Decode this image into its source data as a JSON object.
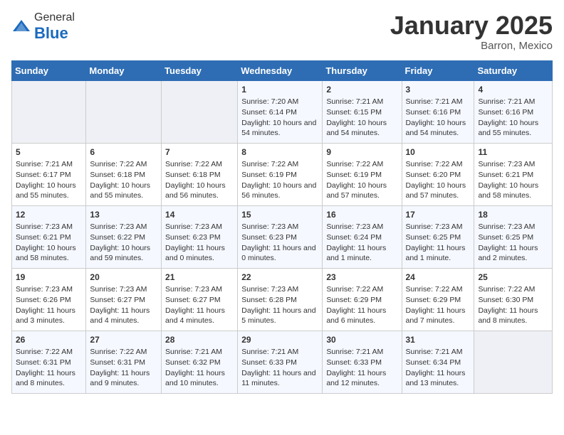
{
  "header": {
    "logo": {
      "general": "General",
      "blue": "Blue"
    },
    "title": "January 2025",
    "location": "Barron, Mexico"
  },
  "days_of_week": [
    "Sunday",
    "Monday",
    "Tuesday",
    "Wednesday",
    "Thursday",
    "Friday",
    "Saturday"
  ],
  "weeks": [
    [
      {
        "day": "",
        "sunrise": "",
        "sunset": "",
        "daylight": ""
      },
      {
        "day": "",
        "sunrise": "",
        "sunset": "",
        "daylight": ""
      },
      {
        "day": "",
        "sunrise": "",
        "sunset": "",
        "daylight": ""
      },
      {
        "day": "1",
        "sunrise": "Sunrise: 7:20 AM",
        "sunset": "Sunset: 6:14 PM",
        "daylight": "Daylight: 10 hours and 54 minutes."
      },
      {
        "day": "2",
        "sunrise": "Sunrise: 7:21 AM",
        "sunset": "Sunset: 6:15 PM",
        "daylight": "Daylight: 10 hours and 54 minutes."
      },
      {
        "day": "3",
        "sunrise": "Sunrise: 7:21 AM",
        "sunset": "Sunset: 6:16 PM",
        "daylight": "Daylight: 10 hours and 54 minutes."
      },
      {
        "day": "4",
        "sunrise": "Sunrise: 7:21 AM",
        "sunset": "Sunset: 6:16 PM",
        "daylight": "Daylight: 10 hours and 55 minutes."
      }
    ],
    [
      {
        "day": "5",
        "sunrise": "Sunrise: 7:21 AM",
        "sunset": "Sunset: 6:17 PM",
        "daylight": "Daylight: 10 hours and 55 minutes."
      },
      {
        "day": "6",
        "sunrise": "Sunrise: 7:22 AM",
        "sunset": "Sunset: 6:18 PM",
        "daylight": "Daylight: 10 hours and 55 minutes."
      },
      {
        "day": "7",
        "sunrise": "Sunrise: 7:22 AM",
        "sunset": "Sunset: 6:18 PM",
        "daylight": "Daylight: 10 hours and 56 minutes."
      },
      {
        "day": "8",
        "sunrise": "Sunrise: 7:22 AM",
        "sunset": "Sunset: 6:19 PM",
        "daylight": "Daylight: 10 hours and 56 minutes."
      },
      {
        "day": "9",
        "sunrise": "Sunrise: 7:22 AM",
        "sunset": "Sunset: 6:19 PM",
        "daylight": "Daylight: 10 hours and 57 minutes."
      },
      {
        "day": "10",
        "sunrise": "Sunrise: 7:22 AM",
        "sunset": "Sunset: 6:20 PM",
        "daylight": "Daylight: 10 hours and 57 minutes."
      },
      {
        "day": "11",
        "sunrise": "Sunrise: 7:23 AM",
        "sunset": "Sunset: 6:21 PM",
        "daylight": "Daylight: 10 hours and 58 minutes."
      }
    ],
    [
      {
        "day": "12",
        "sunrise": "Sunrise: 7:23 AM",
        "sunset": "Sunset: 6:21 PM",
        "daylight": "Daylight: 10 hours and 58 minutes."
      },
      {
        "day": "13",
        "sunrise": "Sunrise: 7:23 AM",
        "sunset": "Sunset: 6:22 PM",
        "daylight": "Daylight: 10 hours and 59 minutes."
      },
      {
        "day": "14",
        "sunrise": "Sunrise: 7:23 AM",
        "sunset": "Sunset: 6:23 PM",
        "daylight": "Daylight: 11 hours and 0 minutes."
      },
      {
        "day": "15",
        "sunrise": "Sunrise: 7:23 AM",
        "sunset": "Sunset: 6:23 PM",
        "daylight": "Daylight: 11 hours and 0 minutes."
      },
      {
        "day": "16",
        "sunrise": "Sunrise: 7:23 AM",
        "sunset": "Sunset: 6:24 PM",
        "daylight": "Daylight: 11 hours and 1 minute."
      },
      {
        "day": "17",
        "sunrise": "Sunrise: 7:23 AM",
        "sunset": "Sunset: 6:25 PM",
        "daylight": "Daylight: 11 hours and 1 minute."
      },
      {
        "day": "18",
        "sunrise": "Sunrise: 7:23 AM",
        "sunset": "Sunset: 6:25 PM",
        "daylight": "Daylight: 11 hours and 2 minutes."
      }
    ],
    [
      {
        "day": "19",
        "sunrise": "Sunrise: 7:23 AM",
        "sunset": "Sunset: 6:26 PM",
        "daylight": "Daylight: 11 hours and 3 minutes."
      },
      {
        "day": "20",
        "sunrise": "Sunrise: 7:23 AM",
        "sunset": "Sunset: 6:27 PM",
        "daylight": "Daylight: 11 hours and 4 minutes."
      },
      {
        "day": "21",
        "sunrise": "Sunrise: 7:23 AM",
        "sunset": "Sunset: 6:27 PM",
        "daylight": "Daylight: 11 hours and 4 minutes."
      },
      {
        "day": "22",
        "sunrise": "Sunrise: 7:23 AM",
        "sunset": "Sunset: 6:28 PM",
        "daylight": "Daylight: 11 hours and 5 minutes."
      },
      {
        "day": "23",
        "sunrise": "Sunrise: 7:22 AM",
        "sunset": "Sunset: 6:29 PM",
        "daylight": "Daylight: 11 hours and 6 minutes."
      },
      {
        "day": "24",
        "sunrise": "Sunrise: 7:22 AM",
        "sunset": "Sunset: 6:29 PM",
        "daylight": "Daylight: 11 hours and 7 minutes."
      },
      {
        "day": "25",
        "sunrise": "Sunrise: 7:22 AM",
        "sunset": "Sunset: 6:30 PM",
        "daylight": "Daylight: 11 hours and 8 minutes."
      }
    ],
    [
      {
        "day": "26",
        "sunrise": "Sunrise: 7:22 AM",
        "sunset": "Sunset: 6:31 PM",
        "daylight": "Daylight: 11 hours and 8 minutes."
      },
      {
        "day": "27",
        "sunrise": "Sunrise: 7:22 AM",
        "sunset": "Sunset: 6:31 PM",
        "daylight": "Daylight: 11 hours and 9 minutes."
      },
      {
        "day": "28",
        "sunrise": "Sunrise: 7:21 AM",
        "sunset": "Sunset: 6:32 PM",
        "daylight": "Daylight: 11 hours and 10 minutes."
      },
      {
        "day": "29",
        "sunrise": "Sunrise: 7:21 AM",
        "sunset": "Sunset: 6:33 PM",
        "daylight": "Daylight: 11 hours and 11 minutes."
      },
      {
        "day": "30",
        "sunrise": "Sunrise: 7:21 AM",
        "sunset": "Sunset: 6:33 PM",
        "daylight": "Daylight: 11 hours and 12 minutes."
      },
      {
        "day": "31",
        "sunrise": "Sunrise: 7:21 AM",
        "sunset": "Sunset: 6:34 PM",
        "daylight": "Daylight: 11 hours and 13 minutes."
      },
      {
        "day": "",
        "sunrise": "",
        "sunset": "",
        "daylight": ""
      }
    ]
  ]
}
